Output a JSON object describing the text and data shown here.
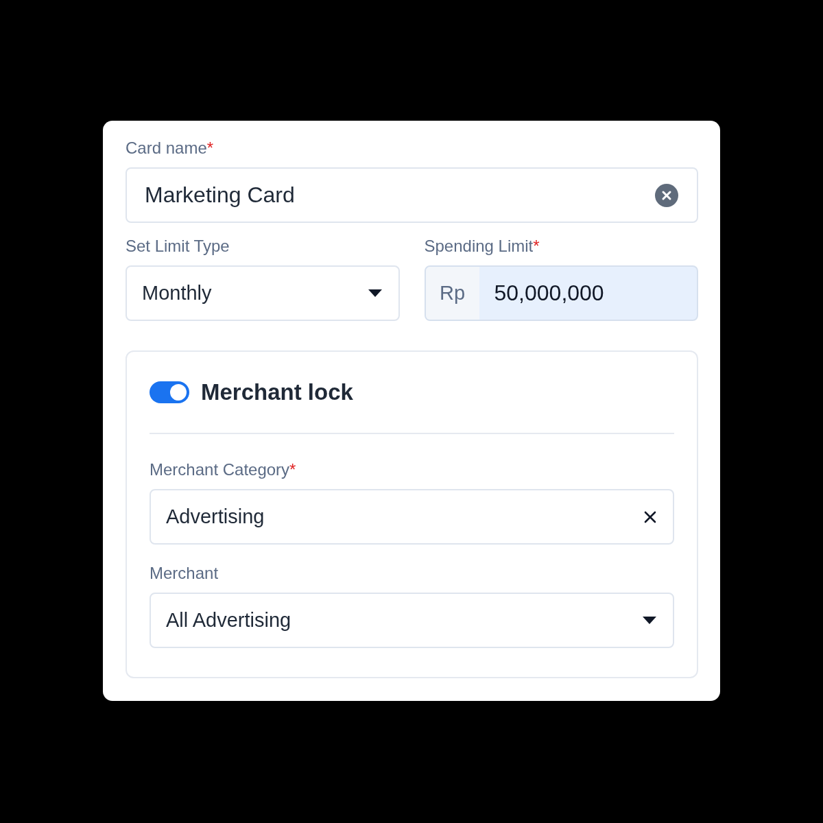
{
  "card_name": {
    "label": "Card name",
    "required_mark": "*",
    "value": "Marketing Card"
  },
  "limit_type": {
    "label": "Set Limit Type",
    "value": "Monthly"
  },
  "spending_limit": {
    "label": "Spending Limit",
    "required_mark": "*",
    "prefix": "Rp",
    "value": "50,000,000"
  },
  "merchant_lock": {
    "title": "Merchant lock",
    "on": true,
    "fields": [
      {
        "kind": "clearable",
        "label": "Merchant Category",
        "required_mark": "*",
        "value": "Advertising"
      },
      {
        "kind": "select",
        "label": "Merchant",
        "value": "All Advertising"
      }
    ]
  }
}
